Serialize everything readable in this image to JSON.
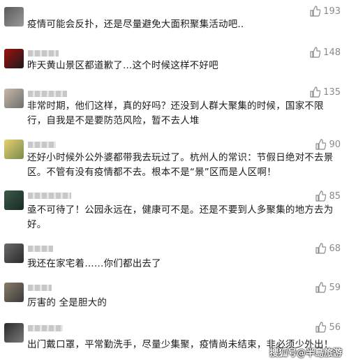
{
  "comments": [
    {
      "likes": "193",
      "text": "疫情可能会反扑，还是尽量避免大面积聚集活动吧.."
    },
    {
      "likes": "148",
      "text": "昨天黄山景区都道歉了...这个时候这样不好吧"
    },
    {
      "likes": "135",
      "text": "非常时期，他们这样，真的好吗？还没到人群大聚集的时候，国家不限行，自我是不是要防范风险，暂不去人堆"
    },
    {
      "likes": "90",
      "text": "还好小时候外公外婆都带我去玩过了。杭州人的常识：节假日绝对不去景区。不管有没有疫情都不去。根本不是“景”区而是人区啊！"
    },
    {
      "likes": "85",
      "text": "亟不可待了！公园永远在，健康可不是。还是不要到人多聚集的地方去为好。"
    },
    {
      "likes": "68",
      "text": "我还在家宅着……你们都出去了"
    },
    {
      "likes": "59",
      "text": "厉害的 全是胆大的"
    },
    {
      "likes": "56",
      "text": "出门戴口罩，平常勤洗手，尽量少集聚，疫情尚未结束，非必须少外出！"
    }
  ],
  "watermark": "搜狐号@半島旅游",
  "icons": {
    "like": "thumbs-up-icon"
  },
  "colors": {
    "text": "#1a1a1a",
    "likes": "#8a8a8a",
    "background": "#ffffff"
  }
}
